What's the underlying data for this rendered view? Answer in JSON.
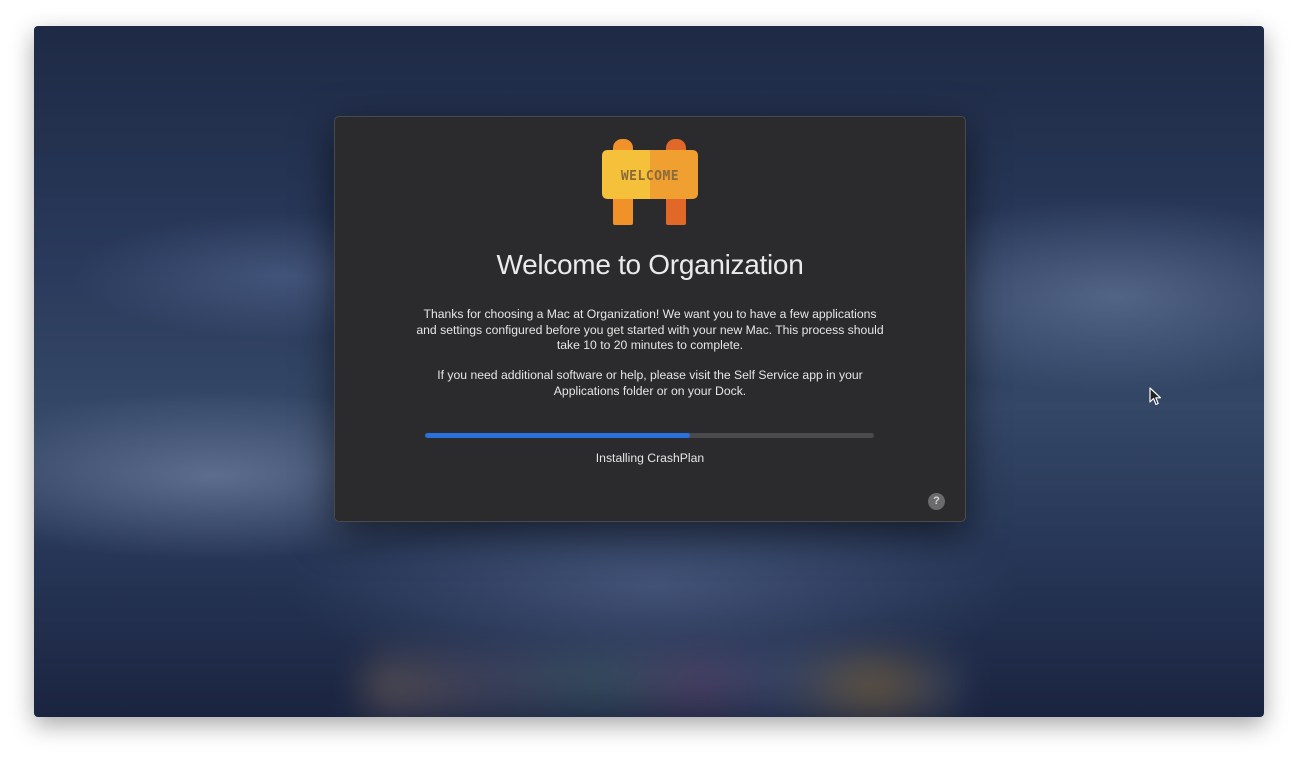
{
  "dialog": {
    "title": "Welcome to Organization",
    "paragraph1": "Thanks for choosing a Mac at Organization! We want you to have a few applications and settings configured before you get started with your new Mac. This process should take 10 to 20 minutes to complete.",
    "paragraph2": "If you need additional software or help, please visit the Self Service app in your Applications folder or on your Dock.",
    "progress_fraction": 0.59,
    "status": "Installing CrashPlan",
    "help_label": "?"
  },
  "icon": {
    "name": "welcome-sign-icon",
    "text": "WELCOME",
    "colors": {
      "board_left": "#f5c13a",
      "board_right": "#f0a030",
      "post_left": "#f0912a",
      "post_right": "#e2682a",
      "lettering": "#8a6a3a"
    }
  },
  "colors": {
    "dialog_bg": "#2b2b2d",
    "progress_fill": "#2a6fdb",
    "progress_track": "#4a4a4c"
  }
}
